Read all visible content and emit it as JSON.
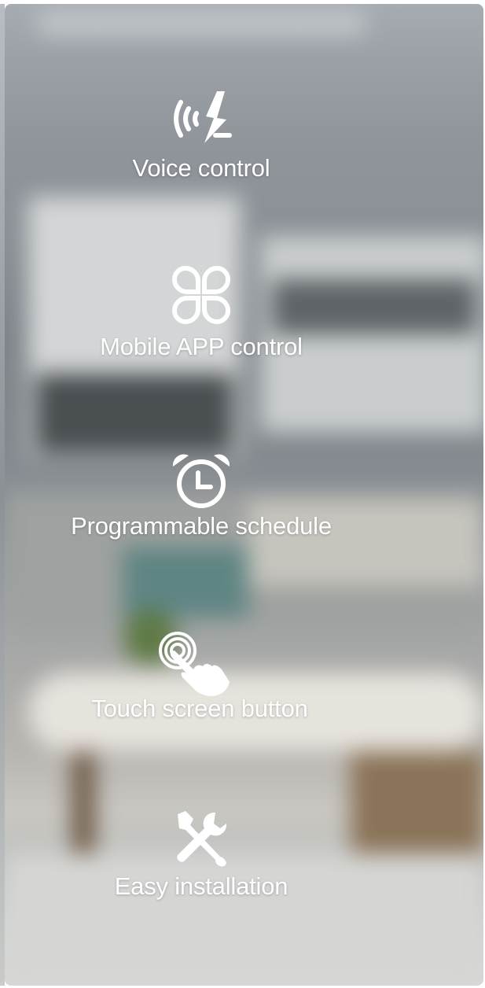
{
  "features": [
    {
      "icon": "voice-control-icon",
      "label": "Voice control"
    },
    {
      "icon": "app-grid-icon",
      "label": "Mobile APP control"
    },
    {
      "icon": "alarm-clock-icon",
      "label": "Programmable schedule"
    },
    {
      "icon": "touch-hand-icon",
      "label": "Touch screen button"
    },
    {
      "icon": "tools-icon",
      "label": "Easy installation"
    }
  ],
  "colors": {
    "text": "#ffffff"
  }
}
